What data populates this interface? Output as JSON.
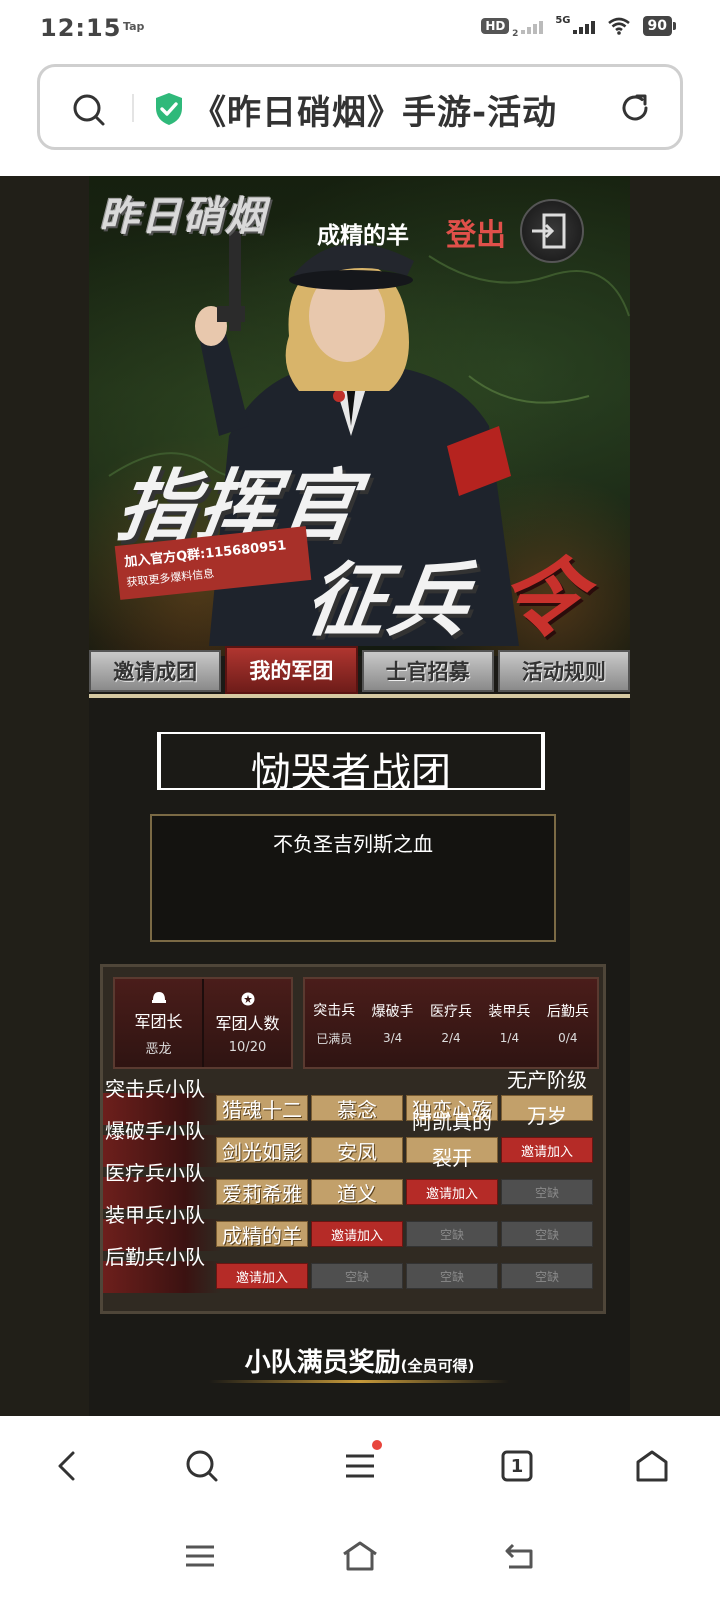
{
  "status": {
    "time": "12:15",
    "app_badge": "Tap",
    "hd": "HD",
    "hd_sub": "2",
    "network": "5G",
    "battery": "90"
  },
  "address": {
    "title": "《昨日硝烟》手游-活动"
  },
  "banner": {
    "logo": "昨日硝烟",
    "username": "成精的羊",
    "logout": "登出",
    "slogan_line1": "指挥官",
    "slogan_line2": "征兵",
    "slogan_line3": "令",
    "qq_group": "加入官方Q群:115680951",
    "qq_note": "获取更多爆料信息"
  },
  "tabs": [
    {
      "label": "邀请成团"
    },
    {
      "label": "我的军团"
    },
    {
      "label": "士官招募"
    },
    {
      "label": "活动规则"
    }
  ],
  "legion": {
    "name": "恸哭者战团",
    "description": "不负圣吉列斯之血"
  },
  "legion_info": {
    "leader_label": "军团长",
    "leader_value": "恶龙",
    "members_label": "军团人数",
    "members_value": "10/20"
  },
  "roles": [
    {
      "name": "突击兵",
      "count": "已满员"
    },
    {
      "name": "爆破手",
      "count": "3/4"
    },
    {
      "name": "医疗兵",
      "count": "2/4"
    },
    {
      "name": "装甲兵",
      "count": "1/4"
    },
    {
      "name": "后勤兵",
      "count": "0/4"
    }
  ],
  "squads": [
    {
      "label": "突击兵小队",
      "slots": [
        {
          "type": "filled",
          "text": "猎魂十二"
        },
        {
          "type": "filled",
          "text": "慕念"
        },
        {
          "type": "filled",
          "text": "独恋心殇"
        },
        {
          "type": "tall",
          "text": "无产阶级万岁"
        }
      ]
    },
    {
      "label": "爆破手小队",
      "slots": [
        {
          "type": "filled",
          "text": "剑光如影"
        },
        {
          "type": "filled",
          "text": "安凤"
        },
        {
          "type": "tall",
          "text": "阿凯真的裂开"
        },
        {
          "type": "invite",
          "text": "邀请加入"
        }
      ]
    },
    {
      "label": "医疗兵小队",
      "slots": [
        {
          "type": "filled",
          "text": "爱莉希雅"
        },
        {
          "type": "filled",
          "text": "道义"
        },
        {
          "type": "invite",
          "text": "邀请加入"
        },
        {
          "type": "empty",
          "text": "空缺"
        }
      ]
    },
    {
      "label": "装甲兵小队",
      "slots": [
        {
          "type": "filled",
          "text": "成精的羊"
        },
        {
          "type": "invite",
          "text": "邀请加入"
        },
        {
          "type": "empty",
          "text": "空缺"
        },
        {
          "type": "empty",
          "text": "空缺"
        }
      ]
    },
    {
      "label": "后勤兵小队",
      "slots": [
        {
          "type": "invite",
          "text": "邀请加入"
        },
        {
          "type": "empty",
          "text": "空缺"
        },
        {
          "type": "empty",
          "text": "空缺"
        },
        {
          "type": "empty",
          "text": "空缺"
        }
      ]
    }
  ],
  "reward": {
    "title": "小队满员奖励",
    "note": "(全员可得)"
  },
  "toolbar": {
    "tab_count": "1",
    "icons": [
      "back-icon",
      "search-icon",
      "menu-icon",
      "tabs-icon",
      "home-icon"
    ]
  },
  "colors": {
    "accent_red": "#b52b27",
    "gold_slot": "#c2a06a",
    "shield_green": "#2fb97a"
  }
}
